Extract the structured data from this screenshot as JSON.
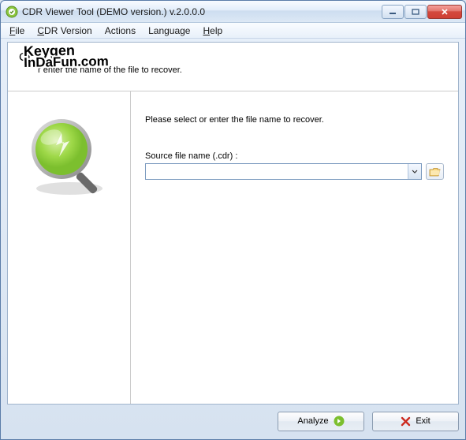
{
  "window": {
    "title": "CDR Viewer Tool (DEMO version.) v.2.0.0.0"
  },
  "menu": {
    "file": "File",
    "cdr_version": "CDR Version",
    "actions": "Actions",
    "language": "Language",
    "help": "Help"
  },
  "header": {
    "title_prefix": "CL",
    "subtitle_suffix": "r enter the name of the file to recover."
  },
  "watermark": {
    "line1": "Keygen",
    "line2": "InDaFun.com"
  },
  "main": {
    "instruction": "Please select or enter the file name to recover.",
    "field_label": "Source file name (.cdr) :",
    "field_value": ""
  },
  "footer": {
    "analyze": "Analyze",
    "exit": "Exit"
  }
}
